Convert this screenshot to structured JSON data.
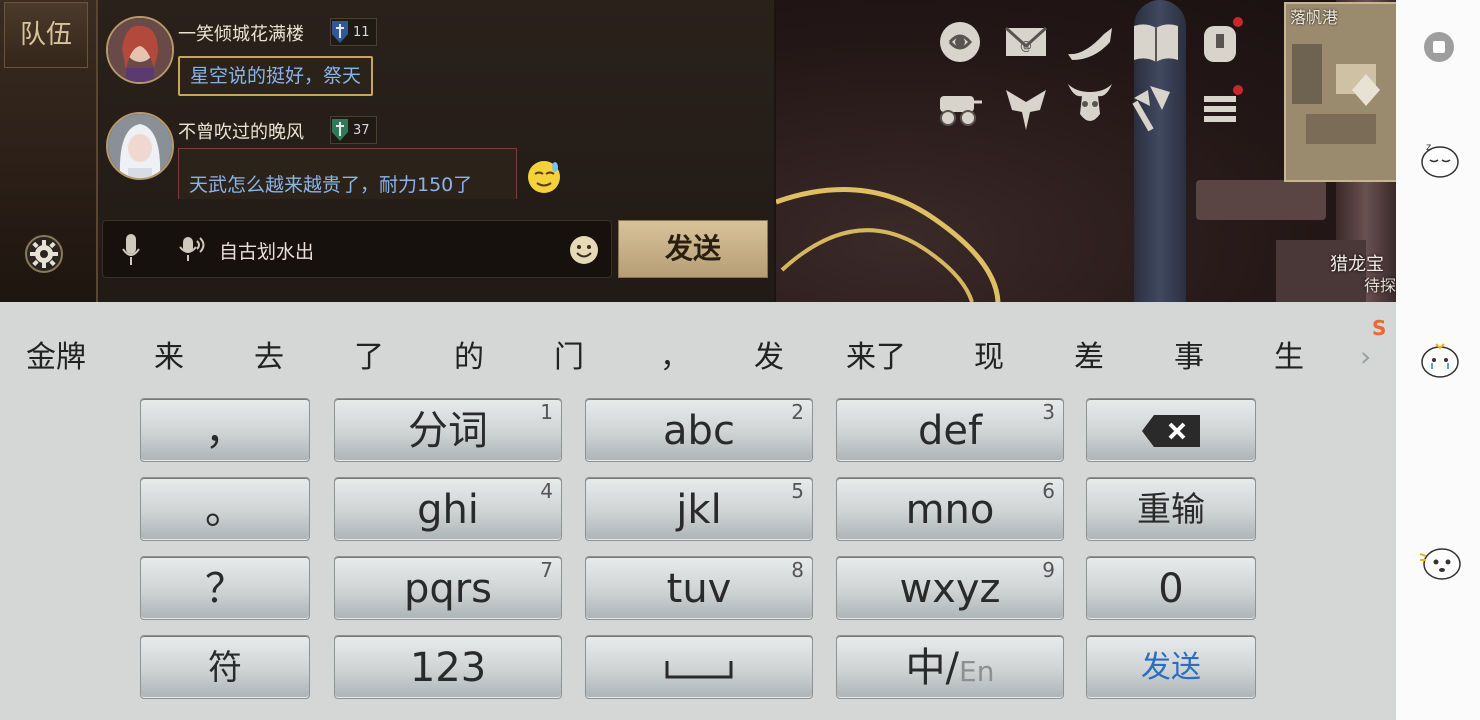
{
  "team_tab": "队伍",
  "chat": {
    "messages": [
      {
        "user": "一笑倾城花满楼",
        "rank": "11",
        "text": "星空说的挺好，祭天"
      },
      {
        "user": "不曾吹过的晚风",
        "rank": "37",
        "text": "天武怎么越来越贵了，耐力150了"
      }
    ],
    "input_value": "自古划水出",
    "send_label": "发送"
  },
  "minimap": {
    "location": "落帆港"
  },
  "quest": {
    "title": "猎龙宝",
    "status": "待探"
  },
  "icons": {
    "top_row1": [
      "rose-icon",
      "mail-icon",
      "horn-icon",
      "book-icon",
      "backpack-icon"
    ],
    "top_row2": [
      "cart-icon",
      "guild-emblem-icon",
      "bull-skull-icon",
      "axe-icon",
      "menu-icon"
    ]
  },
  "keyboard": {
    "candidates": [
      "金牌",
      "来",
      "去",
      "了",
      "的",
      "门",
      "，",
      "发",
      "来了",
      "现",
      "差",
      "事",
      "生"
    ],
    "rows": [
      {
        "left": "，",
        "keys": [
          {
            "label": "分词",
            "hint": "1"
          },
          {
            "label": "abc",
            "hint": "2"
          },
          {
            "label": "def",
            "hint": "3"
          }
        ]
      },
      {
        "left": "。",
        "keys": [
          {
            "label": "ghi",
            "hint": "4"
          },
          {
            "label": "jkl",
            "hint": "5"
          },
          {
            "label": "mno",
            "hint": "6"
          }
        ],
        "right": "重输"
      },
      {
        "left": "？",
        "keys": [
          {
            "label": "pqrs",
            "hint": "7"
          },
          {
            "label": "tuv",
            "hint": "8"
          },
          {
            "label": "wxyz",
            "hint": "9"
          }
        ],
        "right": "0"
      }
    ],
    "bottom": {
      "symbols": "符",
      "numbers": "123",
      "lang_main": "中",
      "lang_sep": "/",
      "lang_alt": "En",
      "send": "发送"
    }
  }
}
